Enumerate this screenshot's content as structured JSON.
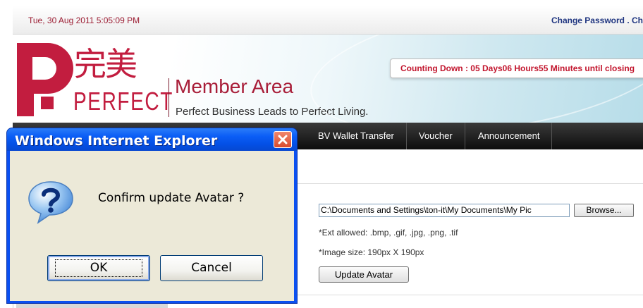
{
  "topbar": {
    "datetime": "Tue, 30 Aug 2011   5:05:09 PM",
    "nav_text": "Change Password . Ch"
  },
  "header": {
    "logo_chinese": "完美",
    "logo_text": "PERFECT",
    "title": "Member Area",
    "slogan": "Perfect Business Leads to Perfect Living.",
    "countdown": "Counting Down : 05 Days06 Hours55 Minutes until closing"
  },
  "navbar": {
    "items": [
      {
        "label": "BV Wallet Transfer"
      },
      {
        "label": "Voucher"
      },
      {
        "label": "Announcement"
      }
    ]
  },
  "avatar_form": {
    "file_path": "C:\\Documents and Settings\\ton-it\\My Documents\\My Pic",
    "browse_label": "Browse...",
    "ext_note": "*Ext allowed: .bmp, .gif, .jpg, .png, .tif",
    "size_note": "*Image size: 190px X 190px",
    "update_label": "Update Avatar"
  },
  "dialog": {
    "title": "Windows Internet Explorer",
    "message": "Confirm update Avatar ?",
    "ok_label": "OK",
    "cancel_label": "Cancel",
    "icon": "question-icon"
  },
  "colors": {
    "brand_red": "#c21d3f",
    "nav_blue": "#1f3580",
    "countdown_red": "#c2152d",
    "xp_blue": "#0a4ff0"
  }
}
